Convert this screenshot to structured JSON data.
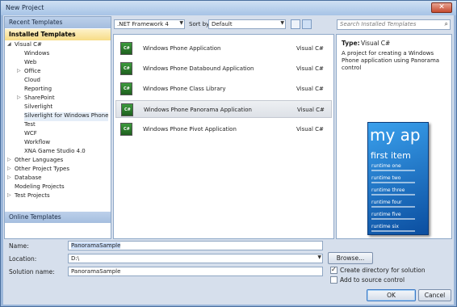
{
  "window": {
    "title": "New Project",
    "close_label": "✕"
  },
  "left": {
    "recent": "Recent Templates",
    "installed": "Installed Templates",
    "online": "Online Templates",
    "tree": [
      {
        "label": "Visual C#",
        "level": 0,
        "arrow": "◢"
      },
      {
        "label": "Windows",
        "level": 1,
        "arrow": ""
      },
      {
        "label": "Web",
        "level": 1,
        "arrow": ""
      },
      {
        "label": "Office",
        "level": 1,
        "arrow": "▷"
      },
      {
        "label": "Cloud",
        "level": 1,
        "arrow": ""
      },
      {
        "label": "Reporting",
        "level": 1,
        "arrow": ""
      },
      {
        "label": "SharePoint",
        "level": 1,
        "arrow": "▷"
      },
      {
        "label": "Silverlight",
        "level": 1,
        "arrow": ""
      },
      {
        "label": "Silverlight for Windows Phone",
        "level": 1,
        "arrow": ""
      },
      {
        "label": "Test",
        "level": 1,
        "arrow": ""
      },
      {
        "label": "WCF",
        "level": 1,
        "arrow": ""
      },
      {
        "label": "Workflow",
        "level": 1,
        "arrow": ""
      },
      {
        "label": "XNA Game Studio 4.0",
        "level": 1,
        "arrow": ""
      },
      {
        "label": "Other Languages",
        "level": 0,
        "arrow": "▷"
      },
      {
        "label": "Other Project Types",
        "level": 0,
        "arrow": "▷"
      },
      {
        "label": "Database",
        "level": 0,
        "arrow": "▷"
      },
      {
        "label": "Modeling Projects",
        "level": 0,
        "arrow": ""
      },
      {
        "label": "Test Projects",
        "level": 0,
        "arrow": "▷"
      }
    ]
  },
  "toolbar": {
    "framework": ".NET Framework 4",
    "sort_label": "Sort by:",
    "sort_value": "Default",
    "search_placeholder": "Search Installed Templates",
    "search_icon": "⌕"
  },
  "templates": [
    {
      "name": "Windows Phone Application",
      "lang": "Visual C#"
    },
    {
      "name": "Windows Phone Databound Application",
      "lang": "Visual C#"
    },
    {
      "name": "Windows Phone Class Library",
      "lang": "Visual C#"
    },
    {
      "name": "Windows Phone Panorama Application",
      "lang": "Visual C#"
    },
    {
      "name": "Windows Phone Pivot Application",
      "lang": "Visual C#"
    }
  ],
  "details": {
    "type_label": "Type:",
    "type_value": "Visual C#",
    "description": "A project for creating a Windows Phone application using Panorama control",
    "preview_title": "my ap",
    "preview_sub": "first item",
    "preview_items": [
      "runtime one",
      "runtime two",
      "runtime three",
      "runtime four",
      "runtime five",
      "runtime six"
    ]
  },
  "form": {
    "name_label": "Name:",
    "name_value": "PanoramaSample",
    "location_label": "Location:",
    "location_value": "D:\\",
    "solution_label": "Solution name:",
    "solution_value": "PanoramaSample",
    "browse": "Browse...",
    "create_dir": "Create directory for solution",
    "add_source": "Add to source control",
    "ok": "OK",
    "cancel": "Cancel"
  }
}
